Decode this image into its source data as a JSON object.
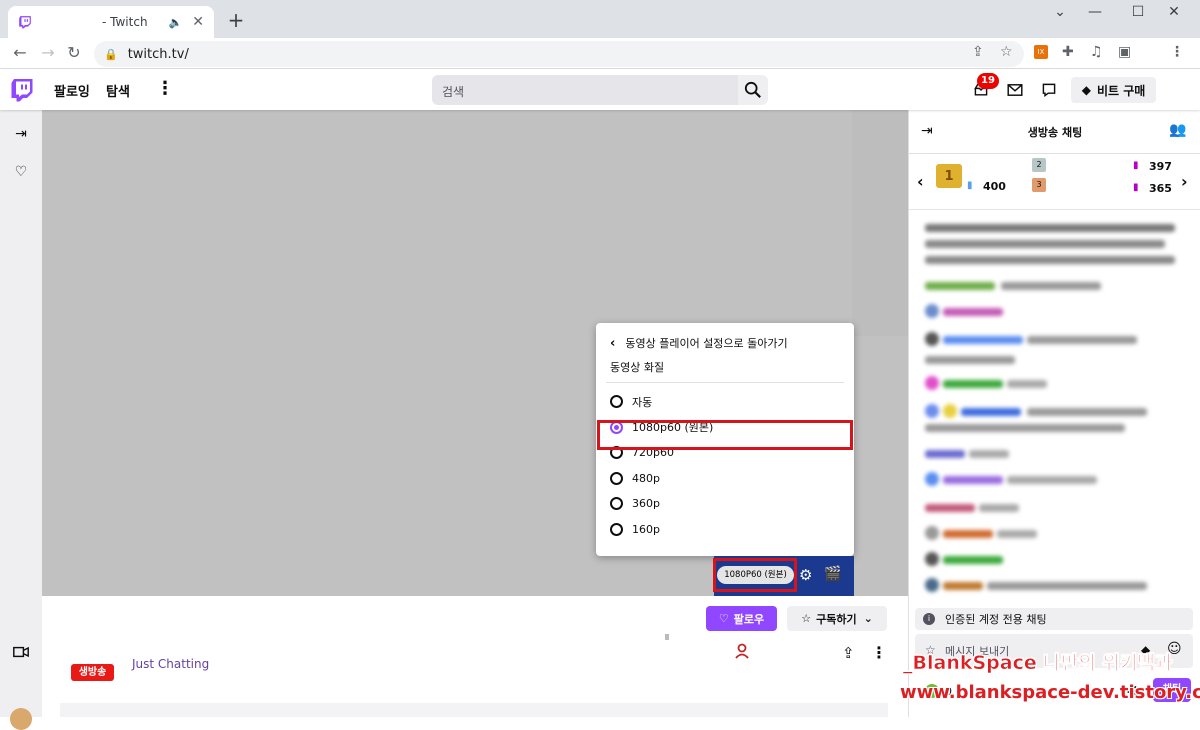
{
  "browser": {
    "tab_title": "- Twitch",
    "tab_audio_icon": "speaker-icon",
    "new_tab": "+",
    "url": "twitch.tv/",
    "window_controls": [
      "—",
      "☐",
      "✕"
    ],
    "tab_dropdown": "⌄"
  },
  "nav": {
    "following": "팔로잉",
    "browse": "탐색",
    "more": "⋮",
    "search_placeholder": "검색",
    "notif_count": "19",
    "bits_label": "비트 구매"
  },
  "video": {
    "quality_menu": {
      "back_label": "동영상 플레이어 설정으로 돌아가기",
      "heading": "동영상 화질",
      "options": [
        "자동",
        "1080p60 (원본)",
        "720p60",
        "480p",
        "360p",
        "160p"
      ],
      "selected_index": 1
    },
    "quality_pill": "1080P60 (원본)"
  },
  "channel": {
    "follow_label": "팔로우",
    "subscribe_label": "구독하기",
    "live_badge": "생방송",
    "category": "Just Chatting"
  },
  "chat": {
    "title": "생방송 채팅",
    "gift_rank1_count": "400",
    "gift_count_a": "397",
    "gift_count_b": "365",
    "verified_notice": "인증된 계정 전용 채팅",
    "input_placeholder": "메시지 보내기",
    "send_label": "채팅",
    "points": "0"
  },
  "watermark": {
    "line1": "_BlankSpace 나만의 위키백과",
    "line2": "www.blankspace-dev.tistory.com"
  },
  "colors": {
    "twitch_purple": "#9147ff",
    "highlight_red": "#d6141b",
    "live_red": "#e91916"
  }
}
